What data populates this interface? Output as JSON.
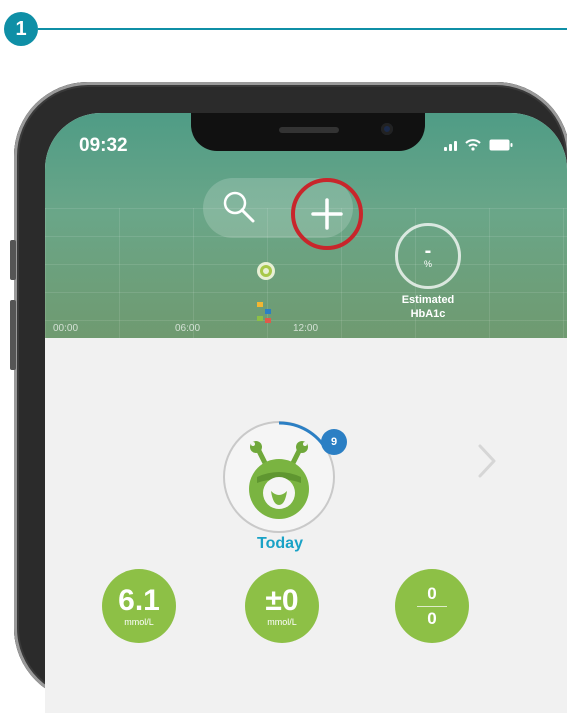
{
  "step": {
    "number": "1"
  },
  "status_bar": {
    "time": "09:32"
  },
  "hero": {
    "hba1c_value": "-",
    "hba1c_unit": "%",
    "hba1c_label": "Estimated\nHbA1c",
    "axis_labels": [
      "00:00",
      "06:00",
      "12:00"
    ]
  },
  "monster": {
    "level_badge": "9",
    "today_label": "Today"
  },
  "stats": [
    {
      "value": "6.1",
      "unit": "mmol/L"
    },
    {
      "value": "±0",
      "unit": "mmol/L"
    },
    {
      "numerator": "0",
      "denominator": "0"
    }
  ],
  "colors": {
    "accent_teal": "#0f8fa6",
    "highlight_red": "#c8262b",
    "stat_green": "#8dc046",
    "today_blue": "#19a2c6"
  },
  "icons": [
    "search-icon",
    "add-icon",
    "target-icon",
    "legend-icon",
    "chevron-right-icon",
    "monster-icon",
    "wifi-icon",
    "battery-icon",
    "signal-icon"
  ]
}
